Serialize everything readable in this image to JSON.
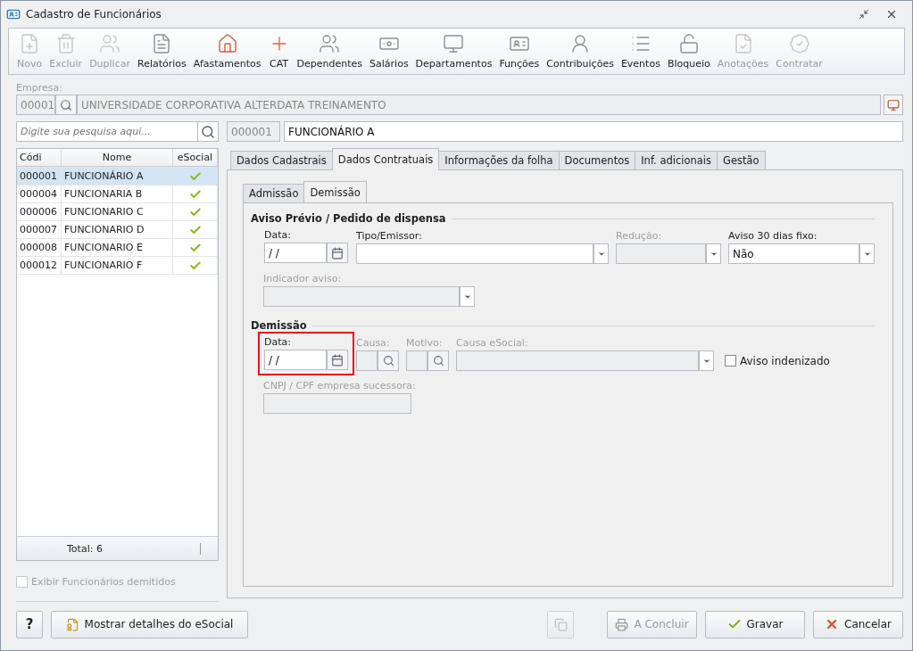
{
  "window": {
    "title": "Cadastro de Funcionários"
  },
  "toolbar": [
    {
      "label": "Novo",
      "disabled": true
    },
    {
      "label": "Excluir",
      "disabled": true
    },
    {
      "label": "Duplicar",
      "disabled": true
    },
    {
      "label": "Relatórios",
      "disabled": false
    },
    {
      "label": "Afastamentos",
      "disabled": false
    },
    {
      "label": "CAT",
      "disabled": false
    },
    {
      "label": "Dependentes",
      "disabled": false
    },
    {
      "label": "Salários",
      "disabled": false
    },
    {
      "label": "Departamentos",
      "disabled": false
    },
    {
      "label": "Funções",
      "disabled": false
    },
    {
      "label": "Contribuições",
      "disabled": false
    },
    {
      "label": "Eventos",
      "disabled": false
    },
    {
      "label": "Bloqueio",
      "disabled": false
    },
    {
      "label": "Anotações",
      "disabled": true
    },
    {
      "label": "Contratar",
      "disabled": true
    }
  ],
  "empresa": {
    "label": "Empresa:",
    "code": "00001",
    "name": "UNIVERSIDADE CORPORATIVA ALTERDATA TREINAMENTO"
  },
  "search": {
    "placeholder": "Digite sua pesquisa aqui..."
  },
  "employee": {
    "code": "000001",
    "name": "FUNCIONÁRIO A"
  },
  "table": {
    "columns": [
      "Códi",
      "Nome",
      "eSocial"
    ],
    "rows": [
      {
        "code": "000001",
        "name": "FUNCIONÁRIO A",
        "esocial": true,
        "selected": true
      },
      {
        "code": "000004",
        "name": "FUNCIONARIA B",
        "esocial": true,
        "selected": false
      },
      {
        "code": "000006",
        "name": "FUNCIONARIO C",
        "esocial": true,
        "selected": false
      },
      {
        "code": "000007",
        "name": "FUNCIONARIO D",
        "esocial": true,
        "selected": false
      },
      {
        "code": "000008",
        "name": "FUNCIONARIO E",
        "esocial": true,
        "selected": false
      },
      {
        "code": "000012",
        "name": "FUNCIONARIO F",
        "esocial": true,
        "selected": false
      }
    ],
    "total": "Total: 6"
  },
  "show_dismissed": {
    "label": "Exibir Funcionários demitidos",
    "checked": false,
    "disabled": true
  },
  "tabs": [
    {
      "label": "Dados Cadastrais",
      "selected": false
    },
    {
      "label": "Dados Contratuais",
      "selected": true
    },
    {
      "label": "Informações da folha",
      "selected": false
    },
    {
      "label": "Documentos",
      "selected": false
    },
    {
      "label": "Inf. adicionais",
      "selected": false
    },
    {
      "label": "Gestão",
      "selected": false
    }
  ],
  "subtabs": [
    {
      "label": "Admissão",
      "selected": false
    },
    {
      "label": "Demissão",
      "selected": true
    }
  ],
  "sections": [
    {
      "title": "Aviso Prévio / Pedido de dispensa",
      "rows": [
        [
          {
            "kind": "date",
            "label": "Data:",
            "value": "/ /",
            "disabled": false,
            "highlighted": false
          },
          {
            "kind": "select",
            "label": "Tipo/Emissor:",
            "disabled": false
          },
          {
            "kind": "select",
            "label": "Redução:",
            "disabled": true
          },
          {
            "kind": "select",
            "label": "Aviso 30 dias fixo:",
            "value": "Não",
            "disabled": false
          }
        ],
        [
          {
            "kind": "select",
            "label": "Indicador aviso:",
            "disabled": true
          }
        ]
      ]
    },
    {
      "title": "Demissão",
      "rows": [
        [
          {
            "kind": "date",
            "label": "Data:",
            "value": "/ /",
            "disabled": false,
            "highlighted": true
          },
          {
            "kind": "lookup",
            "label": "Causa:",
            "disabled": true
          },
          {
            "kind": "lookup",
            "label": "Motivo:",
            "disabled": true
          },
          {
            "kind": "select",
            "label": "Causa eSocial:",
            "disabled": true
          },
          {
            "kind": "checkbox",
            "label": "Aviso indenizado",
            "checked": false,
            "disabled": false
          }
        ],
        [
          {
            "kind": "text",
            "label": "CNPJ / CPF empresa sucessora:",
            "disabled": true
          }
        ]
      ]
    }
  ],
  "buttons": [
    {
      "kind": "help",
      "label": "?",
      "disabled": false
    },
    {
      "kind": "esocial",
      "label": "Mostrar detalhes do eSocial",
      "disabled": false
    },
    {
      "kind": "copy",
      "disabled": true
    },
    {
      "kind": "conclude",
      "label": "A Concluir",
      "disabled": true
    },
    {
      "kind": "save",
      "label": "Gravar",
      "disabled": false
    },
    {
      "kind": "cancel",
      "label": "Cancelar",
      "disabled": false
    }
  ]
}
